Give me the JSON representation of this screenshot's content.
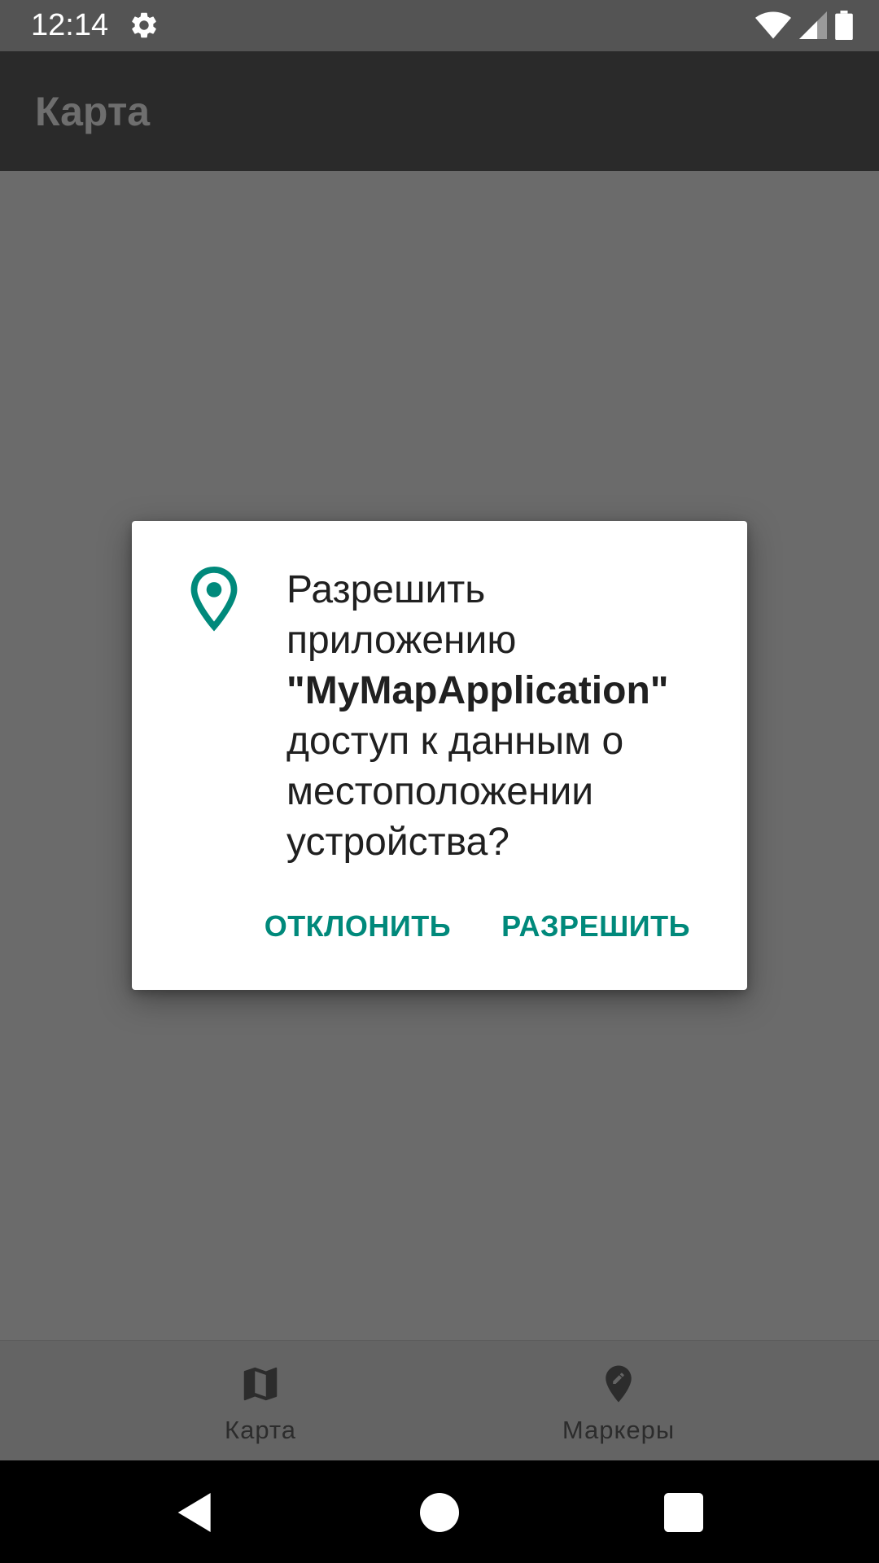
{
  "status_bar": {
    "time": "12:14",
    "icons": [
      "settings-gear-icon",
      "wifi-icon",
      "cell-signal-icon",
      "battery-icon"
    ]
  },
  "app_bar": {
    "title": "Карта"
  },
  "dialog": {
    "icon": "location-pin-icon",
    "message_prefix": "Разрешить приложению",
    "app_name": "\"MyMapApplication\"",
    "message_suffix": "доступ к данным о местоположении устройства?",
    "deny_label": "ОТКЛОНИТЬ",
    "allow_label": "РАЗРЕШИТЬ"
  },
  "bottom_nav": {
    "items": [
      {
        "label": "Карта",
        "icon": "map-icon"
      },
      {
        "label": "Маркеры",
        "icon": "edit-location-icon"
      }
    ]
  },
  "system_nav": {
    "icons": [
      "back-triangle-icon",
      "home-circle-icon",
      "recents-square-icon"
    ]
  },
  "colors": {
    "accent": "#00897b",
    "scrim": "#6b6b6b",
    "app_bar": "#2a2a2a",
    "status_bar": "#545454"
  }
}
